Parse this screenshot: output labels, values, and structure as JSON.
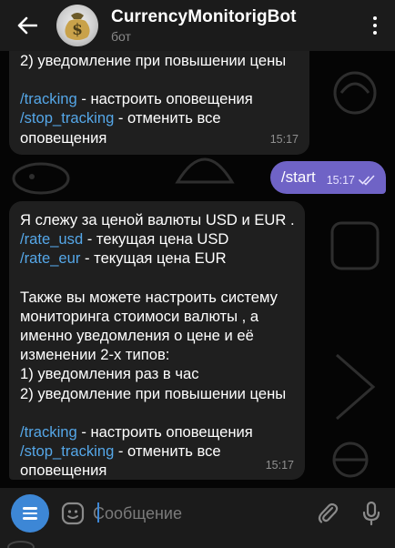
{
  "header": {
    "bot_name": "CurrencyMonitorigBot",
    "status": "бот"
  },
  "messages": {
    "top_partial": {
      "lines": [
        {
          "text": "2) уведомление при повышении цены"
        },
        {
          "gap": true
        },
        {
          "cmd": "/tracking",
          "text": " - настроить оповещения"
        },
        {
          "cmd": "/stop_tracking",
          "text": " - отменить все"
        },
        {
          "text": "оповещения"
        }
      ],
      "time": "15:17"
    },
    "outgoing": {
      "text": "/start",
      "time": "15:17"
    },
    "main": {
      "lines": [
        {
          "text": "Я слежу за ценой валюты USD и EUR ."
        },
        {
          "cmd": "/rate_usd",
          "text": " - текущая цена USD"
        },
        {
          "cmd": "/rate_eur",
          "text": " - текущая цена EUR"
        },
        {
          "gap": true
        },
        {
          "text": "Также вы можете настроить систему"
        },
        {
          "text": "мониторинга стоимоси валюты , а"
        },
        {
          "text": "именно уведомления о цене и её"
        },
        {
          "text": "изменении 2-х типов:"
        },
        {
          "text": "1) уведомления раз в час"
        },
        {
          "text": "2) уведомление при повышении цены"
        },
        {
          "gap": true
        },
        {
          "cmd": "/tracking",
          "text": " - настроить оповещения"
        },
        {
          "cmd": "/stop_tracking",
          "text": " - отменить все"
        },
        {
          "text": "оповещения"
        }
      ],
      "time": "15:17"
    }
  },
  "composer": {
    "placeholder": "Сообщение"
  },
  "icons": {
    "back": "arrow-left-icon",
    "menu": "more-vertical-icon",
    "bot_menu": "hamburger-icon",
    "emoji": "emoji-icon",
    "attach": "paperclip-icon",
    "mic": "microphone-icon",
    "read": "double-check-icon"
  },
  "colors": {
    "accent": "#3d87d6",
    "outgoing_bubble": "#6f63c6",
    "incoming_bubble": "#1f1f1f",
    "command_link": "#55a7e8"
  }
}
